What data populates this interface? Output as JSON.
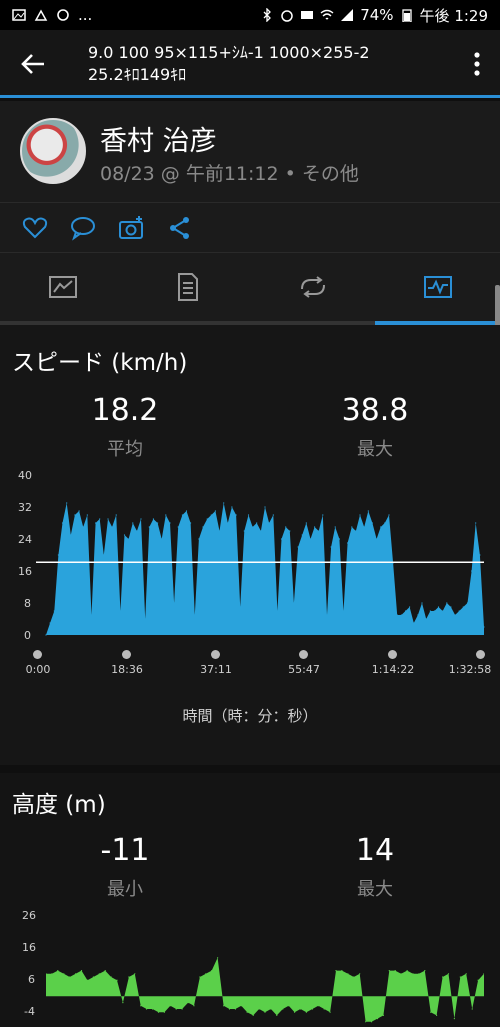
{
  "status": {
    "battery": "74%",
    "clock": "午後 1:29",
    "dots": "..."
  },
  "header": {
    "title_line1": "9.0 100 95×115+ｼﾑ-1 1000×255-2",
    "title_line2": "25.2ｷﾛ149ｷﾛ"
  },
  "profile": {
    "name": "香村 治彦",
    "meta": "08/23 @ 午前11:12 • その他"
  },
  "tabs": [
    {
      "icon": "summary-icon"
    },
    {
      "icon": "details-icon"
    },
    {
      "icon": "laps-icon"
    },
    {
      "icon": "charts-icon",
      "active": true
    }
  ],
  "speed": {
    "title": "スピード (km/h)",
    "avg_value": "18.2",
    "avg_label": "平均",
    "max_value": "38.8",
    "max_label": "最大",
    "x_title": "時間（時：分：秒）"
  },
  "elevation": {
    "title": "高度 (m)",
    "min_value": "-11",
    "min_label": "最小",
    "max_value": "14",
    "max_label": "最大"
  },
  "chart_data": [
    {
      "type": "area",
      "series": [
        {
          "values": [
            0,
            3,
            6,
            20,
            28,
            33,
            25,
            30,
            31,
            27,
            30,
            5,
            28,
            29,
            20,
            29,
            27,
            30,
            6,
            25,
            24,
            28,
            26,
            29,
            4,
            27,
            29,
            28,
            24,
            30,
            28,
            8,
            27,
            30,
            31,
            28,
            5,
            24,
            27,
            29,
            30,
            31,
            26,
            33,
            28,
            32,
            30,
            7,
            26,
            30,
            27,
            28,
            26,
            32,
            28,
            30,
            6,
            24,
            27,
            26,
            8,
            22,
            25,
            28,
            24,
            27,
            26,
            30,
            5,
            22,
            27,
            24,
            6,
            23,
            27,
            26,
            30,
            27,
            31,
            28,
            24,
            27,
            28,
            30,
            18,
            5,
            5,
            6,
            7,
            3,
            5,
            8,
            4,
            6,
            6,
            7,
            6,
            8,
            7,
            5,
            6,
            7,
            8,
            16,
            28,
            20,
            2
          ]
        }
      ],
      "x_tick_labels": [
        "0:00",
        "18:36",
        "37:11",
        "55:47",
        "1:14:22",
        "1:32:58"
      ],
      "y_tick_labels": [
        "0",
        "8",
        "16",
        "24",
        "32",
        "40"
      ],
      "ylim": [
        0,
        40
      ],
      "avg_line": 18.2,
      "color": "#2aa3dc"
    },
    {
      "type": "area",
      "series": [
        {
          "values": [
            7,
            7,
            8,
            7,
            6,
            7,
            8,
            5,
            6,
            7,
            8,
            6,
            5,
            -2,
            6,
            7,
            -3,
            -4,
            -4,
            -5,
            -5,
            -3,
            -4,
            -4,
            -2,
            -3,
            6,
            7,
            8,
            12,
            -3,
            -4,
            -4,
            -3,
            -5,
            -6,
            -4,
            -5,
            -4,
            -6,
            -4,
            -3,
            -5,
            -4,
            -5,
            -4,
            -3,
            -4,
            -5,
            8,
            8,
            7,
            6,
            7,
            -8,
            -8,
            -7,
            -6,
            8,
            8,
            7,
            8,
            7,
            7,
            8,
            -5,
            -6,
            6,
            7,
            -7,
            6,
            7,
            -4,
            5,
            7
          ]
        }
      ],
      "y_tick_labels": [
        "-4",
        "6",
        "16",
        "26"
      ],
      "ylim": [
        -4,
        26
      ],
      "color": "#5bd04a"
    }
  ],
  "colors": {
    "accent": "#2a8fd6",
    "speed_fill": "#2aa3dc",
    "elev_fill": "#5bd04a"
  }
}
